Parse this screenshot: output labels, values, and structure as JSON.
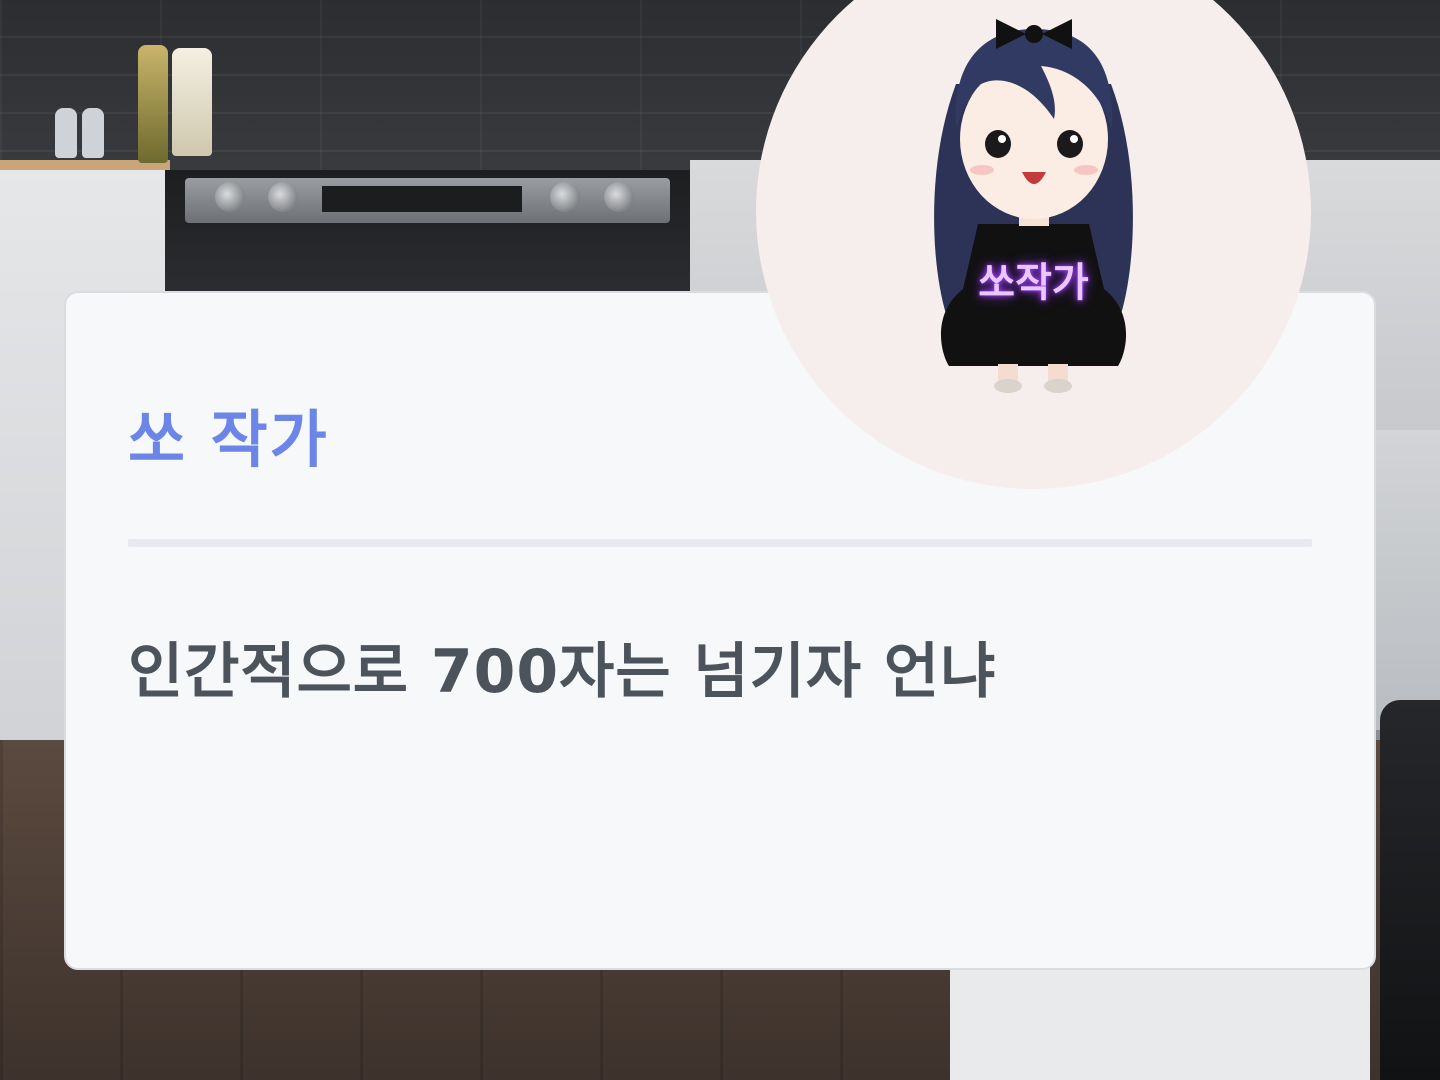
{
  "dialog": {
    "speaker_name": "쏘 작가",
    "text": "인간적으로 700자는 넘기자 언냐"
  },
  "avatar": {
    "label": "쏘작가",
    "icon": "character-portrait"
  },
  "colors": {
    "speaker_name": "#6b86e6",
    "dialog_text": "#4d535b",
    "card_background": "#f6f8fa",
    "avatar_background": "#f6eeed",
    "avatar_label_glow": "#a64dff"
  }
}
